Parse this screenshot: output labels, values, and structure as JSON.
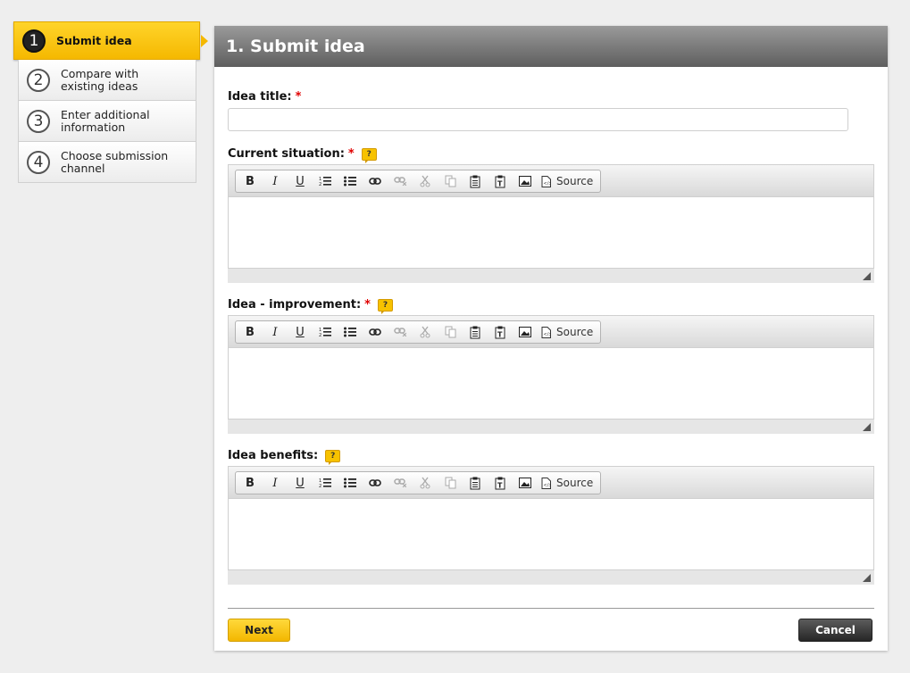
{
  "steps": [
    {
      "number": "1",
      "label": "Submit idea",
      "active": true
    },
    {
      "number": "2",
      "label": "Compare with\nexisting ideas"
    },
    {
      "number": "3",
      "label": "Enter additional\ninformation"
    },
    {
      "number": "4",
      "label": "Choose submission\nchannel"
    }
  ],
  "panel": {
    "title": "1. Submit idea"
  },
  "form": {
    "idea_title": {
      "label": "Idea title:",
      "required": "*",
      "value": ""
    },
    "current_situation": {
      "label": "Current situation:",
      "required": "*",
      "help": "?"
    },
    "idea_improvement": {
      "label": "Idea - improvement:",
      "required": "*",
      "help": "?"
    },
    "idea_benefits": {
      "label": "Idea benefits:",
      "help": "?"
    }
  },
  "toolbar": {
    "bold": "B",
    "italic": "I",
    "underline": "U",
    "source_label": "Source",
    "icons": [
      "bold-icon",
      "italic-icon",
      "underline-icon",
      "numbered-list-icon",
      "bulleted-list-icon",
      "link-icon",
      "unlink-icon",
      "cut-icon",
      "copy-icon",
      "paste-icon",
      "paste-text-icon",
      "image-icon",
      "source-icon"
    ]
  },
  "buttons": {
    "next": "Next",
    "cancel": "Cancel"
  },
  "colors": {
    "accent": "#f5b800",
    "header": "#6e6e6e",
    "required": "#e00000"
  }
}
